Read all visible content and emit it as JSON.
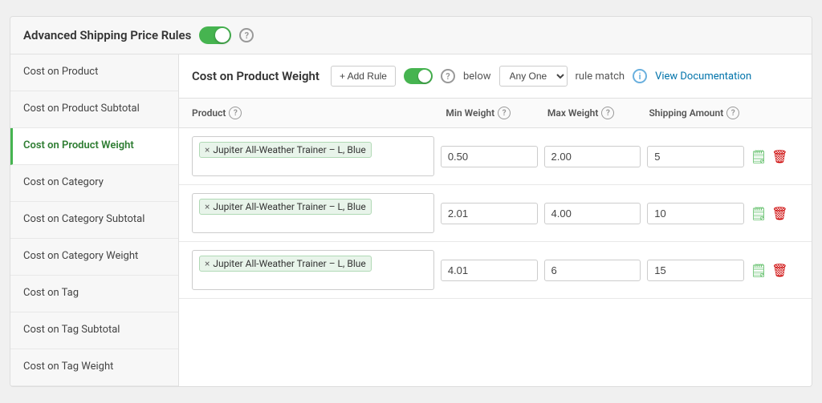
{
  "header": {
    "title": "Advanced Shipping Price Rules"
  },
  "sidebar": {
    "items": [
      {
        "label": "Cost on Product",
        "active": false
      },
      {
        "label": "Cost on Product Subtotal",
        "active": false
      },
      {
        "label": "Cost on Product Weight",
        "active": true
      },
      {
        "label": "Cost on Category",
        "active": false
      },
      {
        "label": "Cost on Category Subtotal",
        "active": false
      },
      {
        "label": "Cost on Category Weight",
        "active": false
      },
      {
        "label": "Cost on Tag",
        "active": false
      },
      {
        "label": "Cost on Tag Subtotal",
        "active": false
      },
      {
        "label": "Cost on Tag Weight",
        "active": false
      }
    ]
  },
  "content": {
    "title": "Cost on Product Weight",
    "add_rule_label": "+ Add Rule",
    "below_label": "below",
    "any_one_label": "Any One",
    "rule_match_label": "rule match",
    "view_docs_label": "View Documentation",
    "table_headers": {
      "product": "Product",
      "min_weight": "Min Weight",
      "max_weight": "Max Weight",
      "shipping_amount": "Shipping Amount"
    },
    "rows": [
      {
        "product_tag": "Jupiter All-Weather Trainer – L, Blue",
        "min_weight": "0.50",
        "max_weight": "2.00",
        "shipping_amount": "5"
      },
      {
        "product_tag": "Jupiter All-Weather Trainer – L, Blue",
        "min_weight": "2.01",
        "max_weight": "4.00",
        "shipping_amount": "10"
      },
      {
        "product_tag": "Jupiter All-Weather Trainer – L, Blue",
        "min_weight": "4.01",
        "max_weight": "6",
        "shipping_amount": "15"
      }
    ]
  }
}
